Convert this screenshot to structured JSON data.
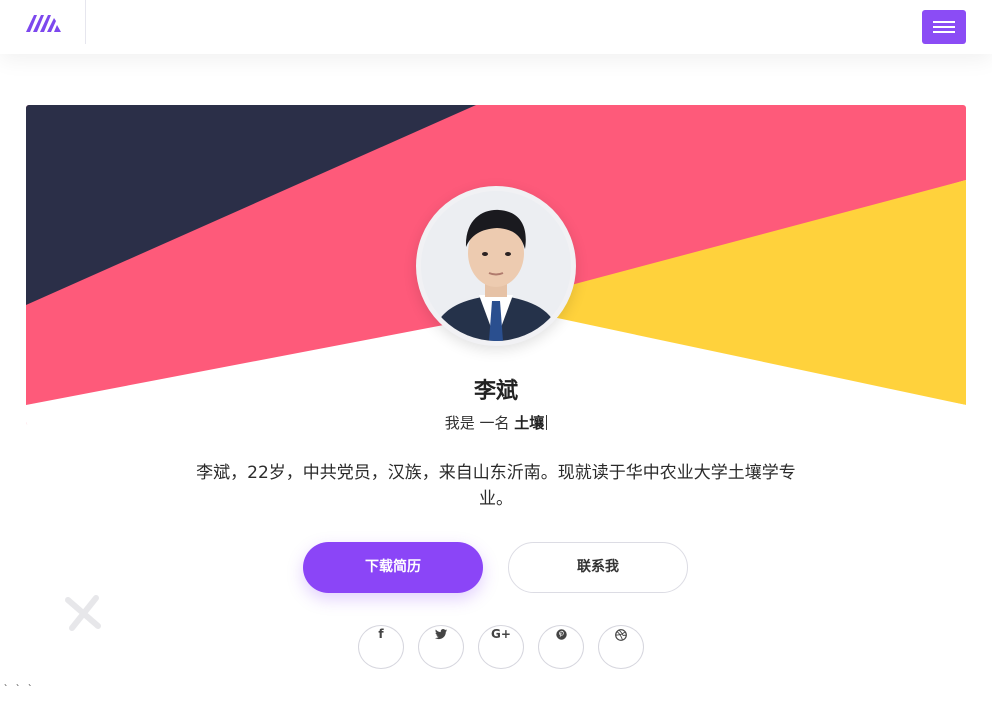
{
  "nav": {
    "logo_icon": "m-logo-icon",
    "menu_icon": "hamburger-icon",
    "brand_color": "#8b4cf5"
  },
  "profile": {
    "name": "李斌",
    "role_prefix": "我是 一名 ",
    "role_highlight": "土壤",
    "bio": "李斌，22岁，中共党员，汉族，来自山东沂南。现就读于华中农业大学土壤学专业。"
  },
  "actions": {
    "download_label": "下载简历",
    "contact_label": "联系我"
  },
  "social": {
    "facebook": "f",
    "twitter": "🐦",
    "google_plus": "G+",
    "pinterest": "℗",
    "dribbble": "⊛"
  },
  "footer": {
    "stray_text": "` ` `"
  },
  "colors": {
    "hero_dark": "#2b2f48",
    "hero_pink": "#fe5a7a",
    "hero_yellow": "#ffd23c",
    "button_purple": "#8b45f7"
  }
}
